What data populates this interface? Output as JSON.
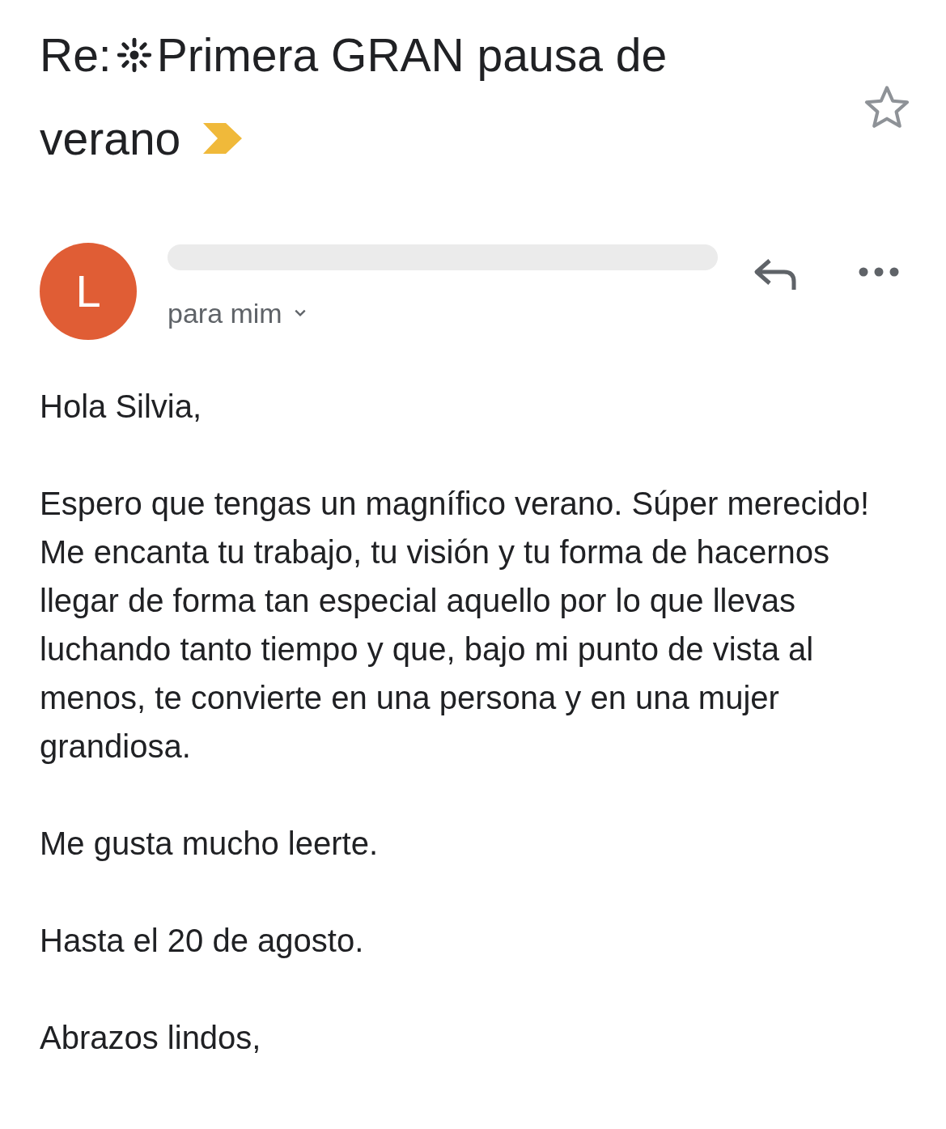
{
  "subject": {
    "prefix": "Re:",
    "lines": [
      "Primera GRAN pausa de",
      "verano"
    ],
    "important": true,
    "starred": false
  },
  "message": {
    "avatar_letter": "L",
    "recipient": "para mim"
  },
  "body": [
    "Hola Silvia,",
    "Espero que tengas un magnífico verano. Súper merecido! Me encanta tu trabajo, tu visión y tu forma de hacernos llegar de forma tan especial aquello por lo que llevas luchando tanto tiempo y que, bajo mi punto de vista al menos, te convierte en una persona y en una mujer grandiosa.",
    "Me gusta mucho leerte.",
    "Hasta el 20 de agosto.",
    "Abrazos lindos,"
  ]
}
